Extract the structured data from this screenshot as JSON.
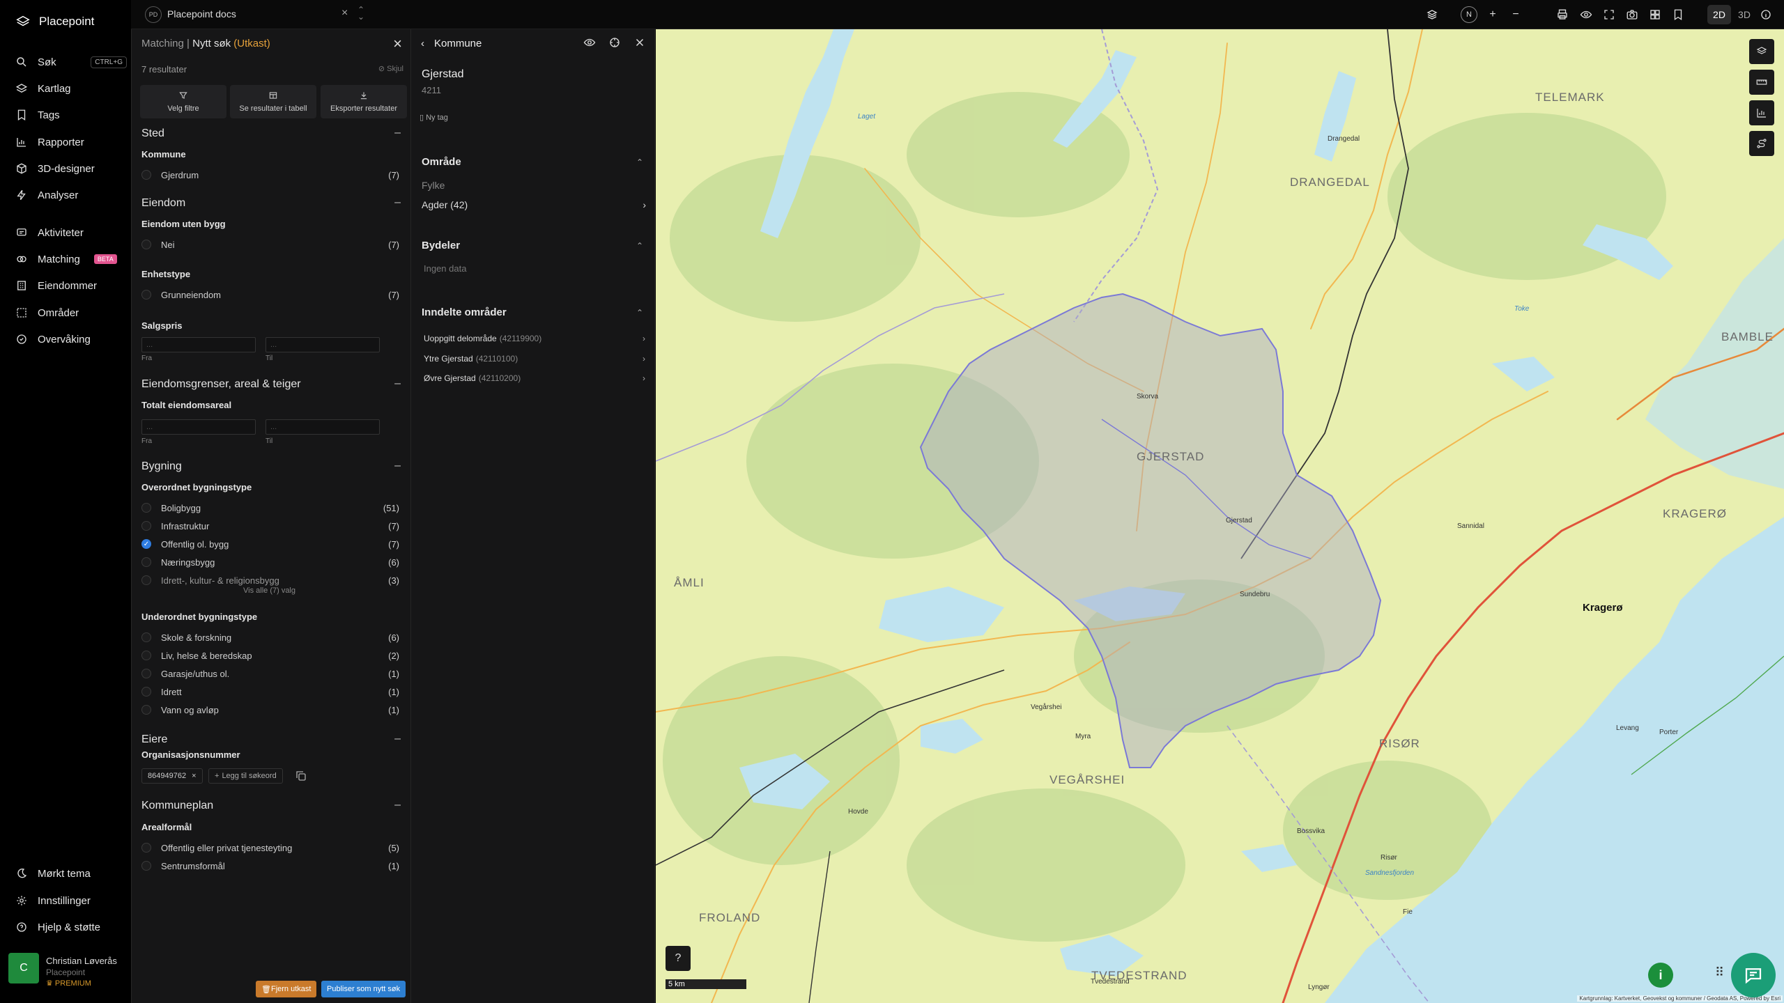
{
  "app": {
    "name": "Placepoint"
  },
  "nav": {
    "items": [
      {
        "label": "Søk",
        "shortcut": "CTRL+G",
        "icon": "search-icon"
      },
      {
        "label": "Kartlag",
        "icon": "layers-icon"
      },
      {
        "label": "Tags",
        "icon": "bookmark-icon"
      },
      {
        "label": "Rapporter",
        "icon": "chart-icon"
      },
      {
        "label": "3D-designer",
        "icon": "cube-icon"
      },
      {
        "label": "Analyser",
        "icon": "bolt-icon"
      },
      {
        "label": "Aktiviteter",
        "icon": "activity-icon"
      },
      {
        "label": "Matching",
        "badge": "BETA",
        "icon": "matching-icon"
      },
      {
        "label": "Eiendommer",
        "icon": "building-icon"
      },
      {
        "label": "Områder",
        "icon": "area-icon"
      },
      {
        "label": "Overvåking",
        "icon": "monitor-icon"
      }
    ],
    "bottom": [
      {
        "label": "Mørkt tema",
        "icon": "moon-icon"
      },
      {
        "label": "Innstillinger",
        "icon": "gear-icon"
      },
      {
        "label": "Hjelp & støtte",
        "icon": "help-icon"
      }
    ],
    "user": {
      "initial": "C",
      "name": "Christian Løverås",
      "org": "Placepoint",
      "tier": "PREMIUM"
    }
  },
  "topbar": {
    "workspace_badge": "PD",
    "workspace_name": "Placepoint docs",
    "north": "N",
    "mode_2d": "2D",
    "mode_3d": "3D"
  },
  "filter": {
    "breadcrumb": "Matching",
    "separator": "|",
    "title": "Nytt søk",
    "status": "(Utkast)",
    "result_count": "7 resultater",
    "hide_label": "Skjul",
    "actions": [
      "Velg filtre",
      "Se resultater i tabell",
      "Eksporter resultater"
    ],
    "sections": {
      "sted": {
        "title": "Sted",
        "kommune_title": "Kommune",
        "kommune": [
          {
            "label": "Gjerdrum",
            "count": "(7)"
          }
        ]
      },
      "eiendom": {
        "title": "Eiendom",
        "uten_bygg_title": "Eiendom uten bygg",
        "uten_bygg": [
          {
            "label": "Nei",
            "count": "(7)"
          }
        ],
        "enhetstype_title": "Enhetstype",
        "enhetstype": [
          {
            "label": "Grunneiendom",
            "count": "(7)"
          }
        ],
        "salgspris_title": "Salgspris",
        "from_label": "Fra",
        "to_label": "Til",
        "placeholder": "..."
      },
      "grenser": {
        "title": "Eiendomsgrenser, areal & teiger",
        "areal_title": "Totalt eiendomsareal",
        "from_label": "Fra",
        "to_label": "Til"
      },
      "bygning": {
        "title": "Bygning",
        "overordnet_title": "Overordnet bygningstype",
        "overordnet": [
          {
            "label": "Boligbygg",
            "count": "(51)",
            "checked": false
          },
          {
            "label": "Infrastruktur",
            "count": "(7)",
            "checked": false
          },
          {
            "label": "Offentlig ol. bygg",
            "count": "(7)",
            "checked": true
          },
          {
            "label": "Næringsbygg",
            "count": "(6)",
            "checked": false
          },
          {
            "label": "Idrett-, kultur- & religionsbygg",
            "count": "(3)",
            "checked": false
          }
        ],
        "show_all": "Vis alle (7) valg",
        "underordnet_title": "Underordnet bygningstype",
        "underordnet": [
          {
            "label": "Skole & forskning",
            "count": "(6)"
          },
          {
            "label": "Liv, helse & beredskap",
            "count": "(2)"
          },
          {
            "label": "Garasje/uthus ol.",
            "count": "(1)"
          },
          {
            "label": "Idrett",
            "count": "(1)"
          },
          {
            "label": "Vann og avløp",
            "count": "(1)"
          }
        ]
      },
      "eiere": {
        "title": "Eiere",
        "org_title": "Organisasjonsnummer",
        "chip": "864949762",
        "add_keyword": "Legg til søkeord"
      },
      "kommuneplan": {
        "title": "Kommuneplan",
        "areal_title": "Arealformål",
        "items": [
          {
            "label": "Offentlig eller privat tjenesteyting",
            "count": "(5)"
          },
          {
            "label": "Sentrumsformål",
            "count": "(1)"
          }
        ]
      }
    },
    "remove_draft": "Fjern utkast",
    "publish": "Publiser som nytt søk"
  },
  "detail": {
    "title": "Kommune",
    "name": "Gjerstad",
    "code": "4211",
    "new_tag": "Ny tag",
    "omrade_title": "Område",
    "fylke_label": "Fylke",
    "fylke_value": "Agder (42)",
    "bydeler_title": "Bydeler",
    "bydeler_empty": "Ingen data",
    "inndelte_title": "Inndelte områder",
    "inndelte": [
      {
        "label": "Uoppgitt delområde",
        "code": "(42119900)"
      },
      {
        "label": "Ytre Gjerstad",
        "code": "(42110100)"
      },
      {
        "label": "Øvre Gjerstad",
        "code": "(42110200)"
      }
    ]
  },
  "map": {
    "labels": {
      "telemark": "TELEMARK",
      "drangedal": "DRANGEDAL",
      "bamble": "BAMBLE",
      "kragero_region": "KRAGERØ",
      "gjerstad": "GJERSTAD",
      "vegarshei": "VEGÅRSHEI",
      "risor": "RISØR",
      "tvedestrand": "TVEDESTRAND",
      "froland": "FROLAND",
      "amli": "ÅMLI",
      "kragero": "Kragerø",
      "drangedal_town": "Drangedal",
      "gjerstad_town": "Gjerstad",
      "sundebru": "Sundebru",
      "myra": "Myra",
      "vegarshei_town": "Vegårshei",
      "risor_town": "Risør",
      "tvedestrand_town": "Tvedestrand",
      "fie": "Fie",
      "lyngor": "Lyngør",
      "sannidal": "Sannidal",
      "levang": "Levang",
      "porter": "Porter",
      "bossvika": "Bossvika",
      "hovdeheia": "Hovde",
      "skorva": "Skorva",
      "laget": "Laget",
      "sandnesfjorden": "Sandnesfjorden",
      "toke": "Toke"
    },
    "scale": "5 km",
    "attribution": "Kartgrunnlag: Kartverket, Geovekst og kommuner / Geodata AS, Powered by Esri"
  },
  "colors": {
    "accent_blue": "#2f7de1",
    "draft_orange": "#e5a13a",
    "beta_pink": "#e2548f",
    "map_land": "#e8efb0",
    "map_water": "#bfe3f0",
    "selection_fill": "#a8a8c8"
  }
}
